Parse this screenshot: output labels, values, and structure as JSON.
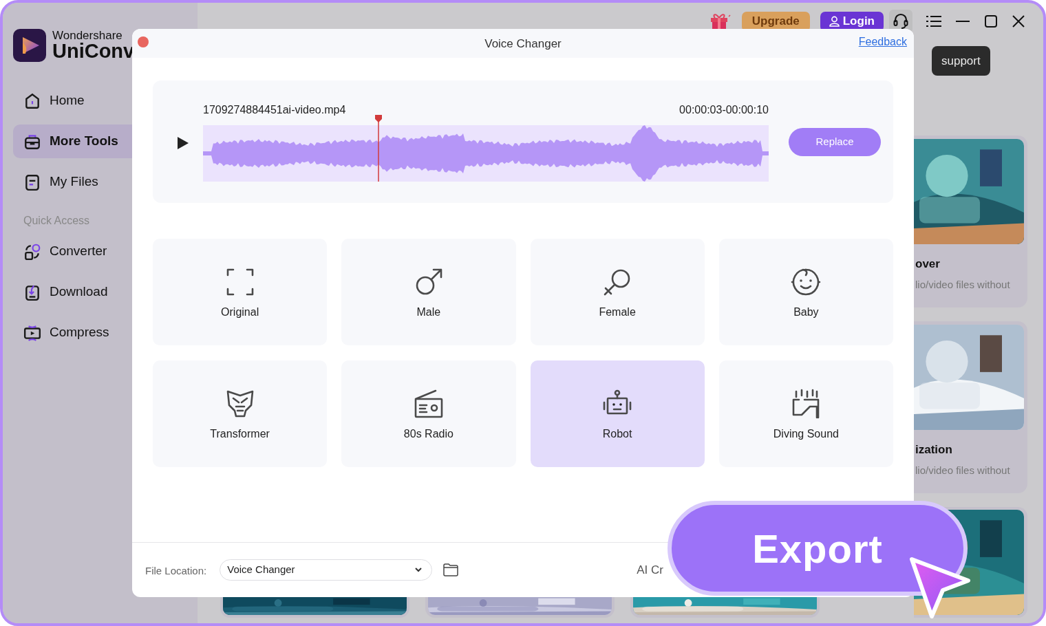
{
  "app": {
    "brand_top": "Wondershare",
    "brand_name": "UniConv"
  },
  "sidebar": {
    "items": [
      {
        "label": "Home",
        "selected": false
      },
      {
        "label": "More Tools",
        "selected": true
      },
      {
        "label": "My Files",
        "selected": false
      }
    ],
    "section_label": "Quick Access",
    "quick_access": [
      {
        "label": "Converter",
        "selected": false
      },
      {
        "label": "Download",
        "selected": false
      },
      {
        "label": "Compress",
        "selected": false
      }
    ]
  },
  "top_bar": {
    "upgrade": "Upgrade",
    "login": "Login",
    "tooltip": "support"
  },
  "background_cards": [
    {
      "title": "over",
      "description": "lio/video files without"
    },
    {
      "title": "ization",
      "description": "lio/video files without"
    }
  ],
  "dialog": {
    "title": "Voice Changer",
    "feedback": "Feedback",
    "file_name": "1709274884451ai-video.mp4",
    "time_range": "00:00:03-00:00:10",
    "playhead": {
      "level": 0.31
    },
    "replace": "Replace",
    "voices": [
      {
        "label": "Original",
        "selected": false
      },
      {
        "label": "Male",
        "selected": false
      },
      {
        "label": "Female",
        "selected": false
      },
      {
        "label": "Baby",
        "selected": false
      },
      {
        "label": "Transformer",
        "selected": false
      },
      {
        "label": "80s Radio",
        "selected": false
      },
      {
        "label": "Robot",
        "selected": true
      },
      {
        "label": "Diving Sound",
        "selected": false
      }
    ],
    "file_location": {
      "label": "File Location:",
      "value": "Voice Changer"
    },
    "partial_text": "AI Cr"
  },
  "export_button": "Export"
}
